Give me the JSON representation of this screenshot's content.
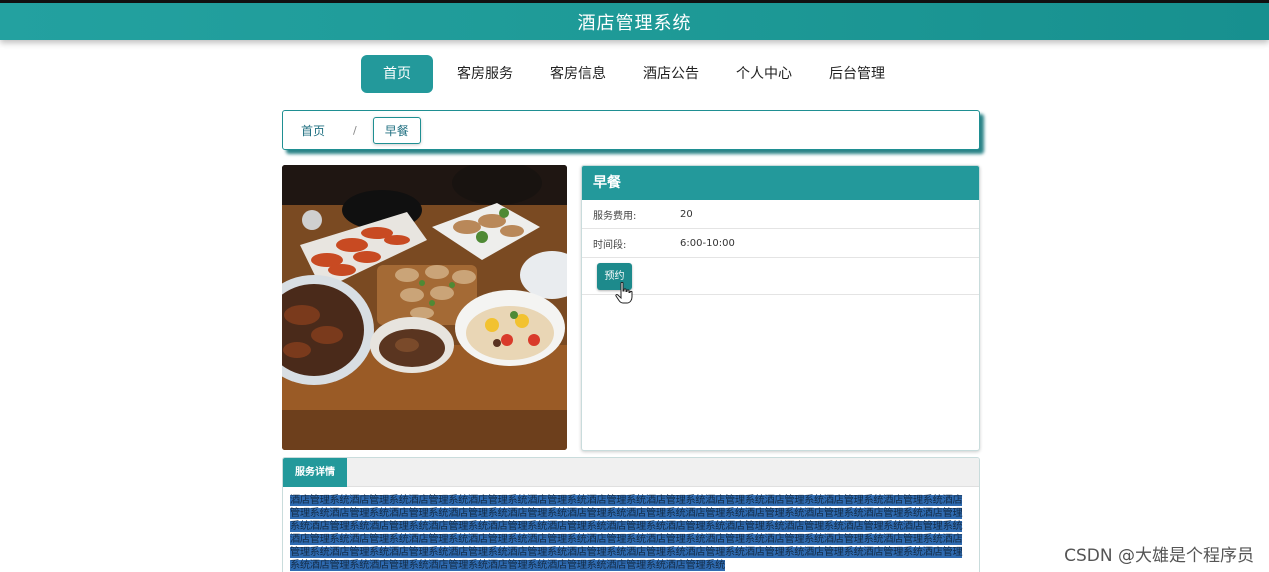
{
  "header": {
    "title": "酒店管理系统"
  },
  "nav": {
    "items": [
      {
        "label": "首页",
        "active": true
      },
      {
        "label": "客房服务"
      },
      {
        "label": "客房信息"
      },
      {
        "label": "酒店公告"
      },
      {
        "label": "个人中心"
      },
      {
        "label": "后台管理"
      }
    ]
  },
  "breadcrumb": {
    "home": "首页",
    "separator": "/",
    "current": "早餐"
  },
  "service": {
    "name": "早餐",
    "fields": [
      {
        "label": "服务费用:",
        "value": "20"
      },
      {
        "label": "时间段:",
        "value": "6:00-10:00"
      }
    ],
    "book_button": "预约"
  },
  "details": {
    "tab_label": "服务详情",
    "text": "酒店管理系统酒店管理系统酒店管理系统酒店管理系统酒店管理系统酒店管理系统酒店管理系统酒店管理系统酒店管理系统酒店管理系统酒店管理系统酒店管理系统酒店管理系统酒店管理系统酒店管理系统酒店管理系统酒店管理系统酒店管理系统酒店管理系统酒店管理系统酒店管理系统酒店管理系统酒店管理系统酒店管理系统酒店管理系统酒店管理系统酒店管理系统酒店管理系统酒店管理系统酒店管理系统酒店管理系统酒店管理系统酒店管理系统酒店管理系统酒店管理系统酒店管理系统酒店管理系统酒店管理系统酒店管理系统酒店管理系统酒店管理系统酒店管理系统酒店管理系统酒店管理系统酒店管理系统酒店管理系统酒店管理系统酒店管理系统酒店管理系统酒店管理系统酒店管理系统酒店管理系统酒店管理系统酒店管理系统酒店管理系统酒店管理系统酒店管理系统酒店管理系统酒店管理系统酒店管理系统酒店管理系统酒店管理系统酒店管理系统酒店管理系统"
  },
  "watermark": "CSDN @大雄是个程序员",
  "colors": {
    "primary": "#23999b",
    "selection": "#2f6bb1"
  },
  "icons": {
    "cursor": "hand-pointer-icon"
  }
}
